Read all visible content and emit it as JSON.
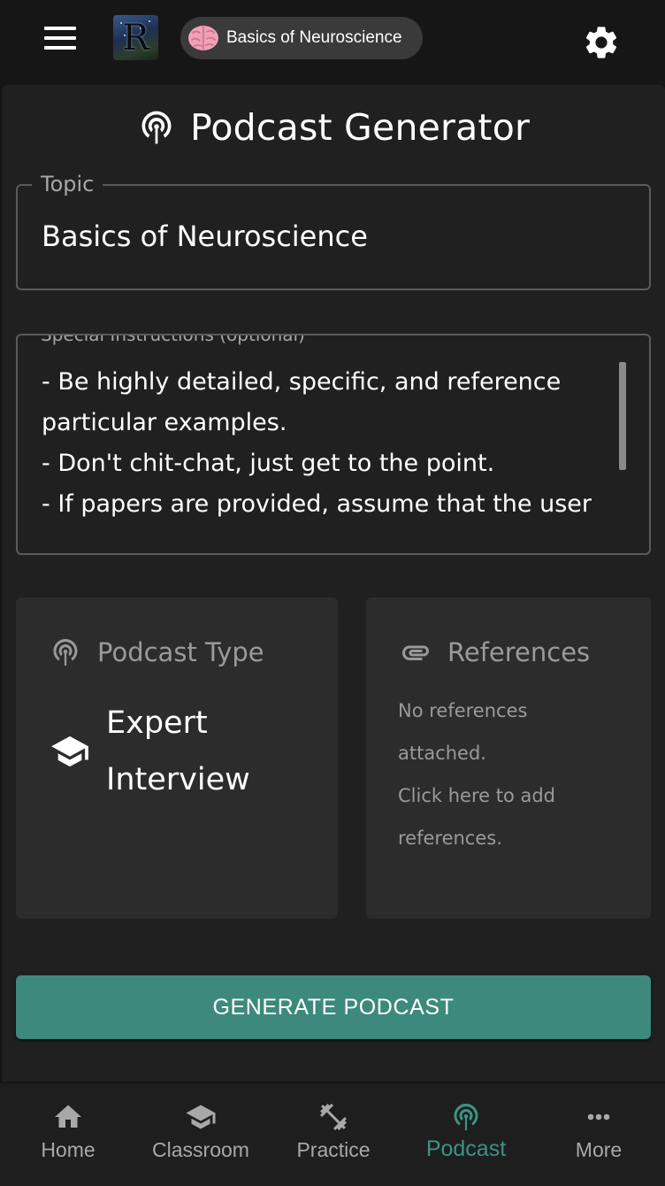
{
  "app": {
    "logo_letter": "R",
    "topic_chip_label": "Basics of Neuroscience"
  },
  "page": {
    "title": "Podcast Generator"
  },
  "form": {
    "topic_label": "Topic",
    "topic_value": "Basics of Neuroscience",
    "instructions_label": "Special Instructions (optional)",
    "instructions_lines": [
      "- Be highly detailed, specific, and reference",
      "particular examples.",
      "- Don't chit-chat, just get to the point.",
      "- If papers are provided, assume that the user"
    ]
  },
  "podcast_type": {
    "heading": "Podcast Type",
    "value_line1": "Expert",
    "value_line2": "Interview"
  },
  "references": {
    "heading": "References",
    "lines": [
      "No references",
      "attached.",
      "Click here to add",
      "references."
    ]
  },
  "actions": {
    "generate_label": "GENERATE PODCAST"
  },
  "nav": {
    "items": [
      {
        "label": "Home",
        "icon": "home-icon"
      },
      {
        "label": "Classroom",
        "icon": "school-icon"
      },
      {
        "label": "Practice",
        "icon": "dumbbell-icon"
      },
      {
        "label": "Podcast",
        "icon": "podcast-icon",
        "active": true
      },
      {
        "label": "More",
        "icon": "more-icon"
      }
    ]
  },
  "colors": {
    "accent": "#3d8a7c",
    "active_nav": "#3d9383",
    "background": "#202020",
    "card": "#2c2c2c"
  }
}
